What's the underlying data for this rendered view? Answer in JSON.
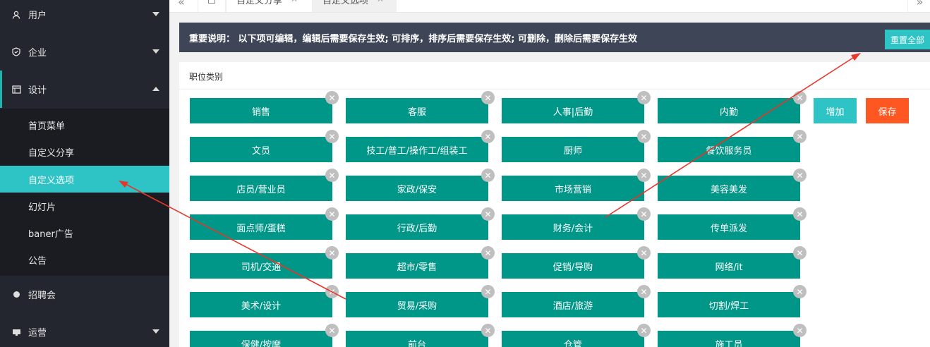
{
  "sidebar": {
    "groups": [
      {
        "label": "用户",
        "icon": "user-icon"
      },
      {
        "label": "企业",
        "icon": "shield-icon"
      },
      {
        "label": "设计",
        "icon": "layout-icon"
      },
      {
        "label": "招聘会",
        "icon": "circle-icon"
      },
      {
        "label": "运营",
        "icon": "monitor-icon"
      }
    ],
    "submenu": [
      "首页菜单",
      "自定义分享",
      "自定义选项",
      "幻灯片",
      "baner广告",
      "公告"
    ],
    "active_submenu": "自定义选项"
  },
  "tabs": [
    {
      "label": "自定义分享",
      "active": false
    },
    {
      "label": "自定义选项",
      "active": true
    }
  ],
  "notice": {
    "text": "重要说明： 以下项可编辑，编辑后需要保存生效; 可排序，排序后需要保存生效; 可删除，删除后需要保存生效",
    "reset_label": "重置全部"
  },
  "card": {
    "title": "职位类别",
    "add_label": "增加",
    "save_label": "保存",
    "close_glyph": "✕",
    "options": [
      "销售",
      "客服",
      "人事|后勤",
      "内勤",
      "文员",
      "技工/普工/操作工/组装工",
      "厨师",
      "餐饮服务员",
      "店员/营业员",
      "家政/保安",
      "市场营销",
      "美容美发",
      "面点师/蛋糕",
      "行政/后勤",
      "财务/会计",
      "传单派发",
      "司机/交通",
      "超市/零售",
      "促销/导购",
      "网络/it",
      "美术/设计",
      "贸易/采购",
      "酒店/旅游",
      "切割/焊工",
      "保健/按摩",
      "前台",
      "仓管",
      "施工员"
    ]
  },
  "colors": {
    "sidebar_bg": "#23262e",
    "accent": "#2ec4c6",
    "option_bg": "#009688",
    "save": "#ff5722",
    "annotation": "#e8362b"
  }
}
